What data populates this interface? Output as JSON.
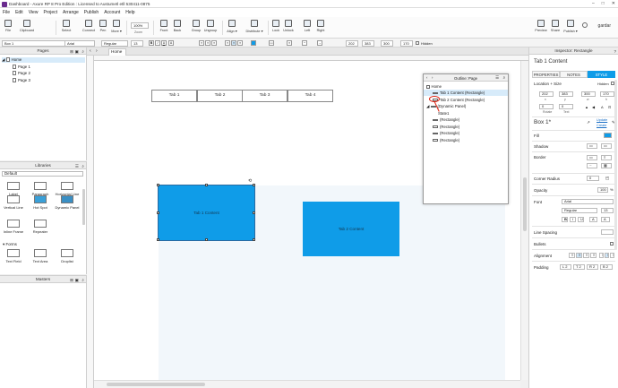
{
  "window": {
    "title": "Dashboard - Axure RP 8 Pro Edition : Licensed to Austumetl etll 530411-0875"
  },
  "menu": [
    "File",
    "Edit",
    "View",
    "Project",
    "Arrange",
    "Publish",
    "Account",
    "Help"
  ],
  "toolbar": {
    "file": "File",
    "clipboard": "Clipboard",
    "select": "Select",
    "connect": "Connect",
    "pen": "Pen",
    "more": "More ▾",
    "zoom_value": "100%",
    "zoom_label": "Zoom",
    "front": "Front",
    "back": "Back",
    "group": "Group",
    "ungroup": "Ungroup",
    "align": "Align ▾",
    "distribute": "Distribute ▾",
    "lock": "Lock",
    "unlock": "Unlock",
    "left": "Left",
    "right": "Right",
    "preview": "Preview",
    "share": "Share",
    "publish": "Publish ▾",
    "user": "gardar"
  },
  "format_bar": {
    "widget_type": "Box 1",
    "font": "Arial",
    "weight": "Regular",
    "size": "13",
    "x": "202",
    "y": "383",
    "w": "300",
    "h": "170",
    "hidden": "Hidden"
  },
  "pages_panel": {
    "title": "Pages",
    "items": [
      "Home",
      "Page 1",
      "Page 2",
      "Page 3"
    ]
  },
  "libraries_panel": {
    "title": "Libraries",
    "selected": "Default",
    "items": [
      "Label",
      "Paragraph",
      "Horizontal Line",
      "Vertical Line",
      "Hot Spot",
      "Dynamic Panel",
      "Inline Frame",
      "Repeater"
    ],
    "forms_header": "Forms",
    "forms": [
      "Text Field",
      "Text Area",
      "Droplist"
    ]
  },
  "masters_panel": {
    "title": "Masters"
  },
  "document": {
    "tab": "Home"
  },
  "canvas": {
    "tabs": [
      "Tab 1",
      "Tab 2",
      "Tab 3",
      "Tab 4"
    ],
    "rect1_label": "Tab 1 Content",
    "rect2_label": "Tab 2 Content"
  },
  "outline": {
    "title": "Outline: Page",
    "rows": [
      "Home",
      "Tab 1 Content (Rectangle)",
      "Tab 2 Content (Rectangle)",
      "(Dynamic Panel)",
      "State1",
      "(Rectangle)",
      "(Rectangle)",
      "(Rectangle)",
      "(Rectangle)"
    ]
  },
  "inspector": {
    "header": "Inspector: Rectangle",
    "name": "Tab 1 Content",
    "tabs": [
      "PROPERTIES",
      "NOTES",
      "STYLE"
    ],
    "location_size": "Location + Size",
    "hidden": "Hidden",
    "x": "202",
    "y": "383",
    "w": "300",
    "h": "170",
    "cap_x": "x",
    "cap_y": "y",
    "cap_w": "w",
    "cap_h": "h",
    "rotate": "0",
    "rotate_label": "Rotate",
    "text_rot": "0",
    "text_label": "Text",
    "style_name": "Box 1*",
    "update": "Update",
    "create": "Create",
    "fill": "Fill",
    "shadow": "Shadow",
    "border": "Border",
    "corner_radius": "Corner Radius",
    "corner_value": "0",
    "opacity": "Opacity",
    "opacity_value": "100",
    "font_label": "Font",
    "font_value": "Arial",
    "font_weight": "Regular",
    "font_size": "13",
    "line_spacing": "Line Spacing",
    "bullets": "Bullets",
    "alignment": "Alignment",
    "padding": "Padding",
    "pad_l": "L 2",
    "pad_t": "T 2",
    "pad_r": "R 2",
    "pad_b": "B 2",
    "accent": "#0f9ce8"
  }
}
